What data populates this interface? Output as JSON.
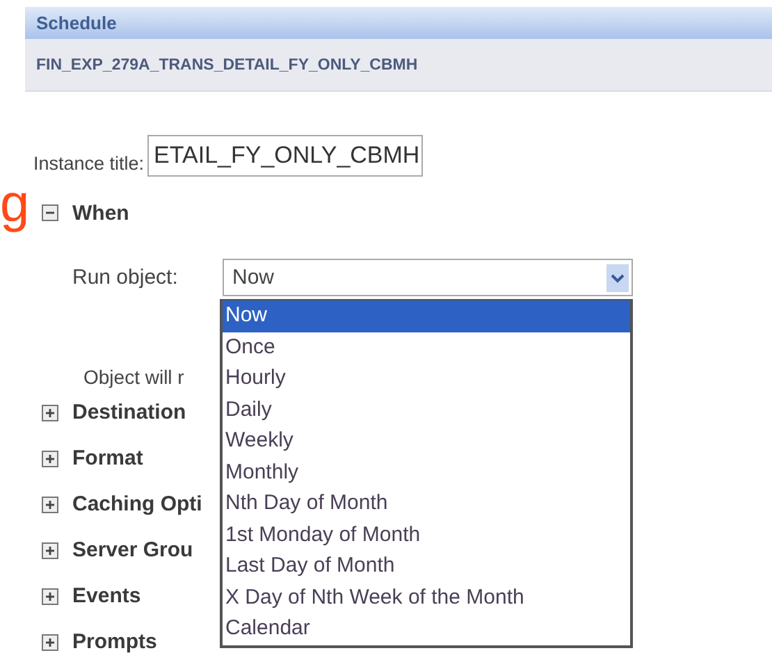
{
  "panel": {
    "title": "Schedule",
    "subtitle": "FIN_EXP_279A_TRANS_DETAIL_FY_ONLY_CBMH"
  },
  "instance_title": {
    "label": "Instance title:",
    "value": "ETAIL_FY_ONLY_CBMH"
  },
  "side_label": "g",
  "sections": [
    {
      "label": "When",
      "expanded": true
    },
    {
      "label": "Destination",
      "expanded": false
    },
    {
      "label": "Format",
      "expanded": false
    },
    {
      "label": "Caching Opti",
      "expanded": false
    },
    {
      "label": "Server Grou",
      "expanded": false
    },
    {
      "label": "Events",
      "expanded": false
    },
    {
      "label": "Prompts",
      "expanded": false
    }
  ],
  "run_object": {
    "label": "Run object:",
    "value": "Now",
    "open": true,
    "note": "Object will r",
    "options": [
      {
        "label": "Now",
        "selected": true
      },
      {
        "label": "Once",
        "selected": false
      },
      {
        "label": "Hourly",
        "selected": false
      },
      {
        "label": "Daily",
        "selected": false
      },
      {
        "label": "Weekly",
        "selected": false
      },
      {
        "label": "Monthly",
        "selected": false
      },
      {
        "label": "Nth Day of Month",
        "selected": false
      },
      {
        "label": "1st Monday of Month",
        "selected": false
      },
      {
        "label": "Last Day of Month",
        "selected": false
      },
      {
        "label": "X Day of Nth Week of the Month",
        "selected": false
      },
      {
        "label": "Calendar",
        "selected": false
      }
    ]
  }
}
